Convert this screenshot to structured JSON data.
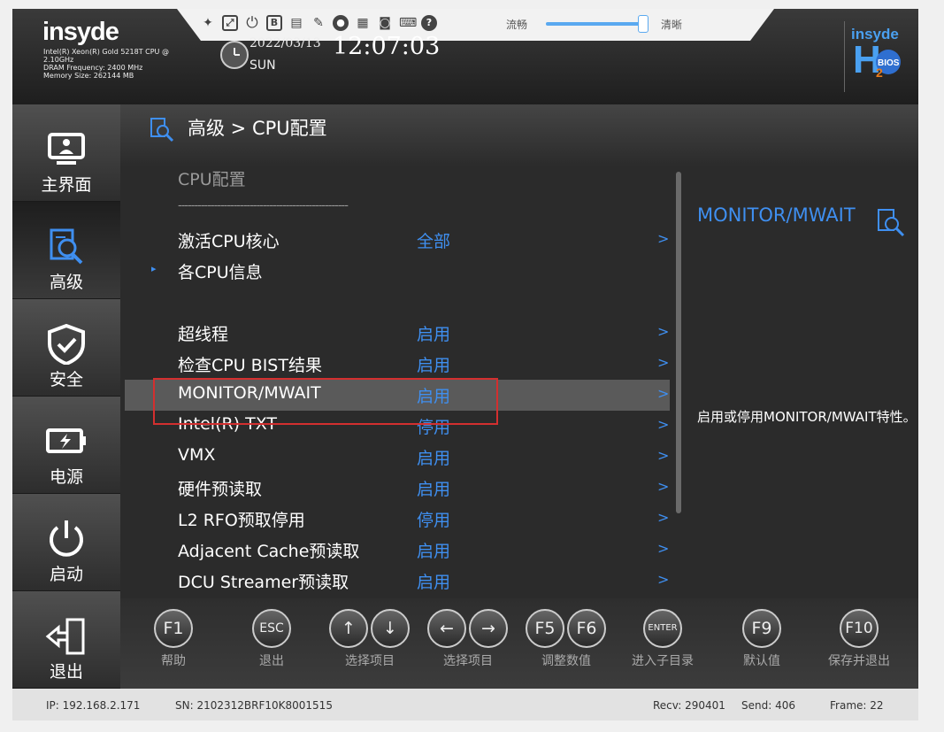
{
  "header": {
    "logo": "insyde",
    "system_info": [
      "Intel(R) Xeon(R) Gold 5218T CPU @",
      "2.10GHz",
      "DRAM Frequency: 2400 MHz",
      "Memory Size: 262144 MB"
    ],
    "date": "2022/03/13",
    "day": "SUN",
    "time": "12:07:03",
    "brand_top": "insyde",
    "brand_bios": "BIOS",
    "toolbar": {
      "icons": [
        "pin-icon",
        "fit-screen-icon",
        "power-icon",
        "b-icon",
        "floppy-icon",
        "mouse-icon",
        "record-icon",
        "save-icon",
        "camera-icon",
        "keyboard-icon",
        "help-icon"
      ],
      "b_label": "B",
      "help_label": "?",
      "slider_left_label": "流畅",
      "slider_right_label": "清晰",
      "slider_level": 1.0
    }
  },
  "sidebar": {
    "items": [
      {
        "label": "主界面",
        "icon": "monitor-icon",
        "active": false
      },
      {
        "label": "高级",
        "icon": "advanced-icon",
        "active": true
      },
      {
        "label": "安全",
        "icon": "shield-icon",
        "active": false
      },
      {
        "label": "电源",
        "icon": "battery-icon",
        "active": false
      },
      {
        "label": "启动",
        "icon": "power-icon",
        "active": false
      },
      {
        "label": "退出",
        "icon": "exit-icon",
        "active": false
      }
    ]
  },
  "main": {
    "breadcrumb": "高级 > CPU配置",
    "section_title": "CPU配置",
    "separator": "----------------------------------------------------",
    "rows": [
      {
        "label": "激活CPU核心",
        "value": "全部",
        "arrow": ">"
      },
      {
        "label": "各CPU信息",
        "value": "",
        "arrow": "",
        "bullet": "▸"
      },
      {
        "label": "超线程",
        "value": "启用",
        "arrow": ">"
      },
      {
        "label": "检查CPU BIST结果",
        "value": "启用",
        "arrow": ">"
      },
      {
        "label": "MONITOR/MWAIT",
        "value": "启用",
        "arrow": ">"
      },
      {
        "label": "Intel(R) TXT",
        "value": "停用",
        "arrow": ">"
      },
      {
        "label": "VMX",
        "value": "启用",
        "arrow": ">"
      },
      {
        "label": "硬件预读取",
        "value": "启用",
        "arrow": ">"
      },
      {
        "label": "L2 RFO预取停用",
        "value": "停用",
        "arrow": ">"
      },
      {
        "label": "Adjacent Cache预读取",
        "value": "启用",
        "arrow": ">"
      },
      {
        "label": "DCU Streamer预读取",
        "value": "启用",
        "arrow": ">"
      }
    ],
    "help_title": "MONITOR/MWAIT",
    "help_description": "启用或停用MONITOR/MWAIT特性。"
  },
  "footer": {
    "keys": [
      {
        "keys": [
          "F1"
        ],
        "label": "帮助"
      },
      {
        "keys": [
          "ESC"
        ],
        "label": "退出"
      },
      {
        "keys": [
          "↑",
          "↓"
        ],
        "label": "选择项目"
      },
      {
        "keys": [
          "←",
          "→"
        ],
        "label": "选择项目"
      },
      {
        "keys": [
          "F5",
          "F6"
        ],
        "label": "调整数值"
      },
      {
        "keys": [
          "ENTER"
        ],
        "label": "进入子目录"
      },
      {
        "keys": [
          "F9"
        ],
        "label": "默认值"
      },
      {
        "keys": [
          "F10"
        ],
        "label": "保存并退出"
      }
    ]
  },
  "statusbar": {
    "ip": "IP: 192.168.2.171",
    "sn": "SN: 2102312BRF10K8001515",
    "recv": "Recv: 290401",
    "send": "Send: 406",
    "frame": "Frame: 22"
  },
  "colors": {
    "accent": "#3f8ff0",
    "highlight_row": "#5a5a5a",
    "selection_box": "#d32f2f"
  }
}
